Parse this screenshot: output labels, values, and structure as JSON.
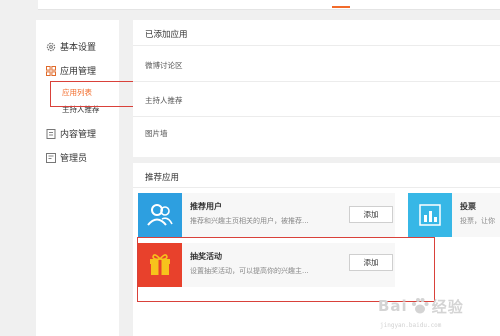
{
  "sidebar": {
    "items": [
      {
        "label": "基本设置",
        "icon": "gear-icon"
      },
      {
        "label": "应用管理",
        "icon": "grid-icon"
      },
      {
        "label": "内容管理",
        "icon": "document-icon"
      },
      {
        "label": "管理员",
        "icon": "user-card-icon"
      }
    ],
    "sub_items": [
      {
        "label": "应用列表",
        "active": true
      },
      {
        "label": "主持人推荐",
        "active": false
      }
    ]
  },
  "added_apps": {
    "title": "已添加应用",
    "items": [
      "微博讨论区",
      "主持人推荐",
      "图片墙"
    ]
  },
  "recommended": {
    "title": "推荐应用",
    "cards": [
      {
        "name": "推荐用户",
        "desc": "推荐和兴趣主页相关的用户，被推荐...",
        "button": "添加",
        "icon": "users-icon",
        "color": "#2d9fe0"
      },
      {
        "name": "投票",
        "desc": "投票，让你",
        "icon": "bar-chart-icon",
        "color": "#37b7e6"
      },
      {
        "name": "抽奖活动",
        "desc": "设置抽奖活动，可以提高你的兴趣主...",
        "button": "添加",
        "icon": "gift-icon",
        "color": "#e8412c"
      }
    ]
  },
  "watermark": {
    "text_left": "Bai",
    "text_right": "经验",
    "url": "jingyan.baidu.com"
  },
  "colors": {
    "accent": "#f26b2a",
    "highlight_border": "#d9413a"
  }
}
